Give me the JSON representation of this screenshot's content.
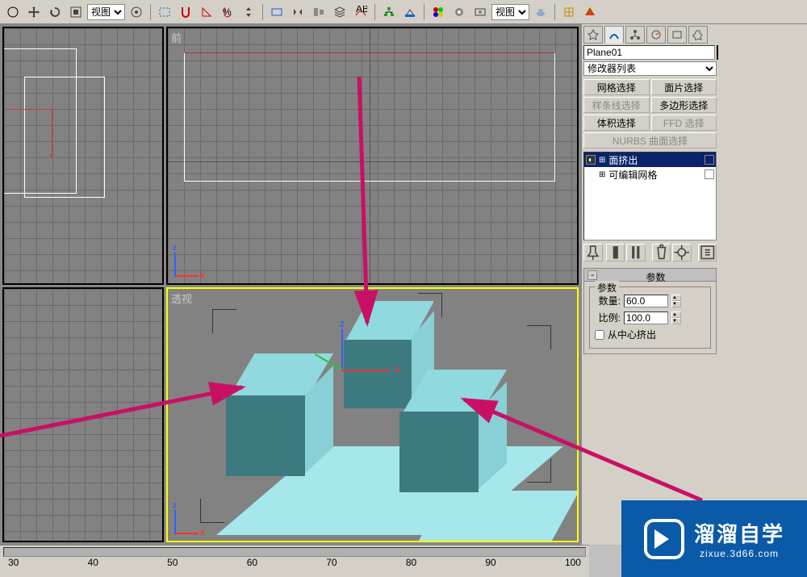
{
  "toolbar": {
    "view_label": "视图",
    "view_label2": "视图"
  },
  "viewports": {
    "tl_label": "",
    "front_label": "前",
    "bl_label": "",
    "persp_label": "透视"
  },
  "cmd": {
    "object_name": "Plane01",
    "modifier_list": "修改器列表",
    "btn_mesh_select": "网格选择",
    "btn_patch_select": "面片选择",
    "btn_spline_select": "样条线选择",
    "btn_poly_select": "多边形选择",
    "btn_vol_select": "体积选择",
    "btn_ffd_select": "FFD 选择",
    "btn_nurbs": "NURBS 曲面选择",
    "mod_stack": [
      {
        "name": "面挤出",
        "selected": true,
        "expandable": true
      },
      {
        "name": "可编辑网格",
        "selected": false,
        "expandable": true
      }
    ],
    "rollout_params_title": "参数",
    "param_group_title": "参数",
    "param_amount_label": "数量:",
    "param_amount_value": "60.0",
    "param_scale_label": "比例:",
    "param_scale_value": "100.0",
    "param_center_extrude": "从中心挤出"
  },
  "ruler": {
    "ticks": [
      "30",
      "40",
      "50",
      "60",
      "70",
      "80",
      "90",
      "100"
    ]
  },
  "watermark": {
    "main": "溜溜自学",
    "sub": "zixue.3d66.com"
  }
}
